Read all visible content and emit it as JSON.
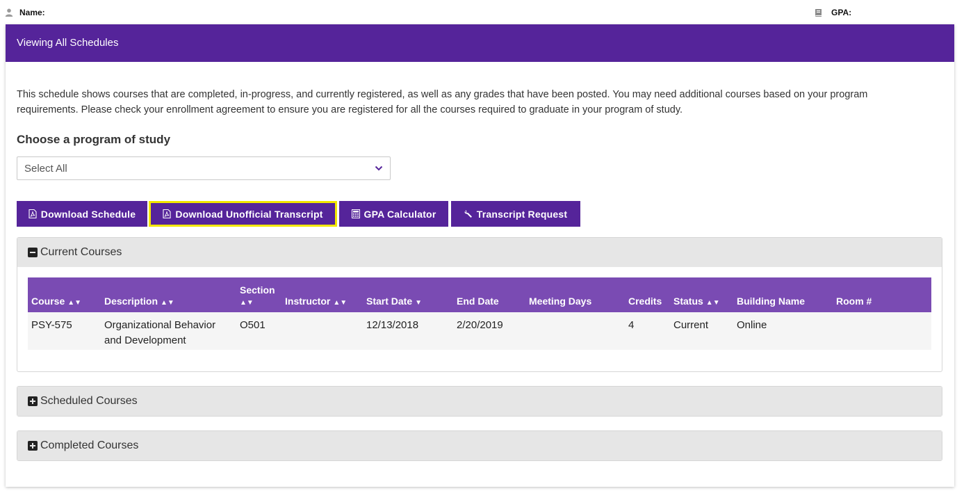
{
  "topbar": {
    "name_label": "Name:",
    "gpa_label": "GPA:"
  },
  "header": {
    "title": "Viewing All Schedules"
  },
  "intro": "This schedule shows courses that are completed, in-progress, and currently registered, as well as any grades that have been posted. You may need additional courses based on your program requirements. Please check your enrollment agreement to ensure you are registered for all the courses required to graduate in your program of study.",
  "program": {
    "heading": "Choose a program of study",
    "selected": "Select All"
  },
  "buttons": {
    "download_schedule": "Download Schedule",
    "download_transcript": "Download Unofficial Transcript",
    "gpa_calculator": "GPA Calculator",
    "transcript_request": "Transcript Request"
  },
  "panels": {
    "current": "Current Courses",
    "scheduled": "Scheduled Courses",
    "completed": "Completed Courses"
  },
  "table": {
    "columns": {
      "course": "Course",
      "description": "Description",
      "section": "Section",
      "instructor": "Instructor",
      "start_date": "Start Date",
      "end_date": "End Date",
      "meeting_days": "Meeting Days",
      "credits": "Credits",
      "status": "Status",
      "building_name": "Building Name",
      "room": "Room #"
    },
    "rows": [
      {
        "course": "PSY-575",
        "description": "Organizational Behavior and Development",
        "section": "O501",
        "instructor": "",
        "start_date": "12/13/2018",
        "end_date": "2/20/2019",
        "meeting_days": "",
        "credits": "4",
        "status": "Current",
        "building_name": "Online",
        "room": ""
      }
    ]
  },
  "colors": {
    "brand": "#55249a",
    "table_header": "#7a4bb3",
    "highlight": "#f2e600",
    "panel_header": "#e6e6e6"
  },
  "icons": {
    "user": "user-icon",
    "book": "book-icon",
    "chevron": "chevron-down-icon",
    "pdf": "pdf-icon",
    "calculator": "calculator-icon",
    "wrench": "wrench-icon",
    "minus": "minus-square-icon",
    "plus": "plus-square-icon",
    "sort": "sort-icon"
  }
}
